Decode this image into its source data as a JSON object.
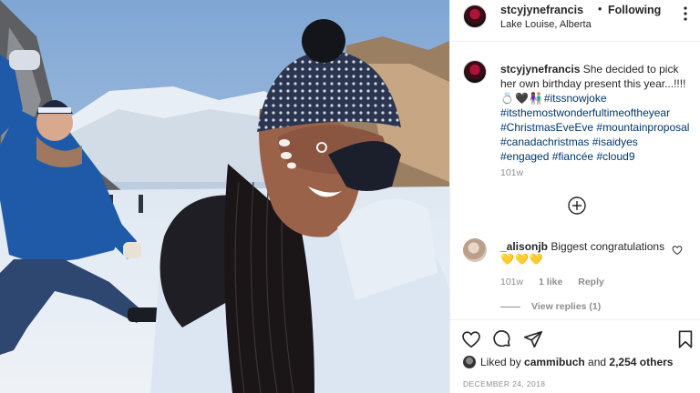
{
  "post": {
    "username": "stcyjynefrancis",
    "separator": "•",
    "follow_label": "Following",
    "location": "Lake Louise, Alberta"
  },
  "caption": {
    "username": "stcyjynefrancis",
    "text": " She decided to pick her own birthday present this year...!!!!",
    "emoji": "💍🖤👩🏾‍🤝‍👨🏼",
    "hashtags": [
      "#itssnowjoke",
      "#itsthemostwonderfultimeoftheyear",
      "#ChristmasEveEve",
      "#mountainproposal",
      "#canadachristmas",
      "#isaidyes",
      "#engaged",
      "#fiancée",
      "#cloud9"
    ],
    "time": "101w"
  },
  "comment": {
    "username": "_alisonjb",
    "text": " Biggest congratulations",
    "emoji": "💛💛💛",
    "time": "101w",
    "likes": "1 like",
    "reply": "Reply",
    "view_replies": "View replies (1)"
  },
  "likes": {
    "prefix": "Liked by ",
    "user": "cammibuch",
    "middle": " and ",
    "count": "2,254 others"
  },
  "date": "DECEMBER 24, 2018",
  "icons": [
    "more-icon",
    "load-more-comments-icon",
    "comment-heart-icon",
    "like-icon",
    "comment-icon",
    "share-icon",
    "save-icon"
  ],
  "colors": {
    "hashtag": "#00376b",
    "muted": "#8e8e8e",
    "text": "#262626"
  }
}
